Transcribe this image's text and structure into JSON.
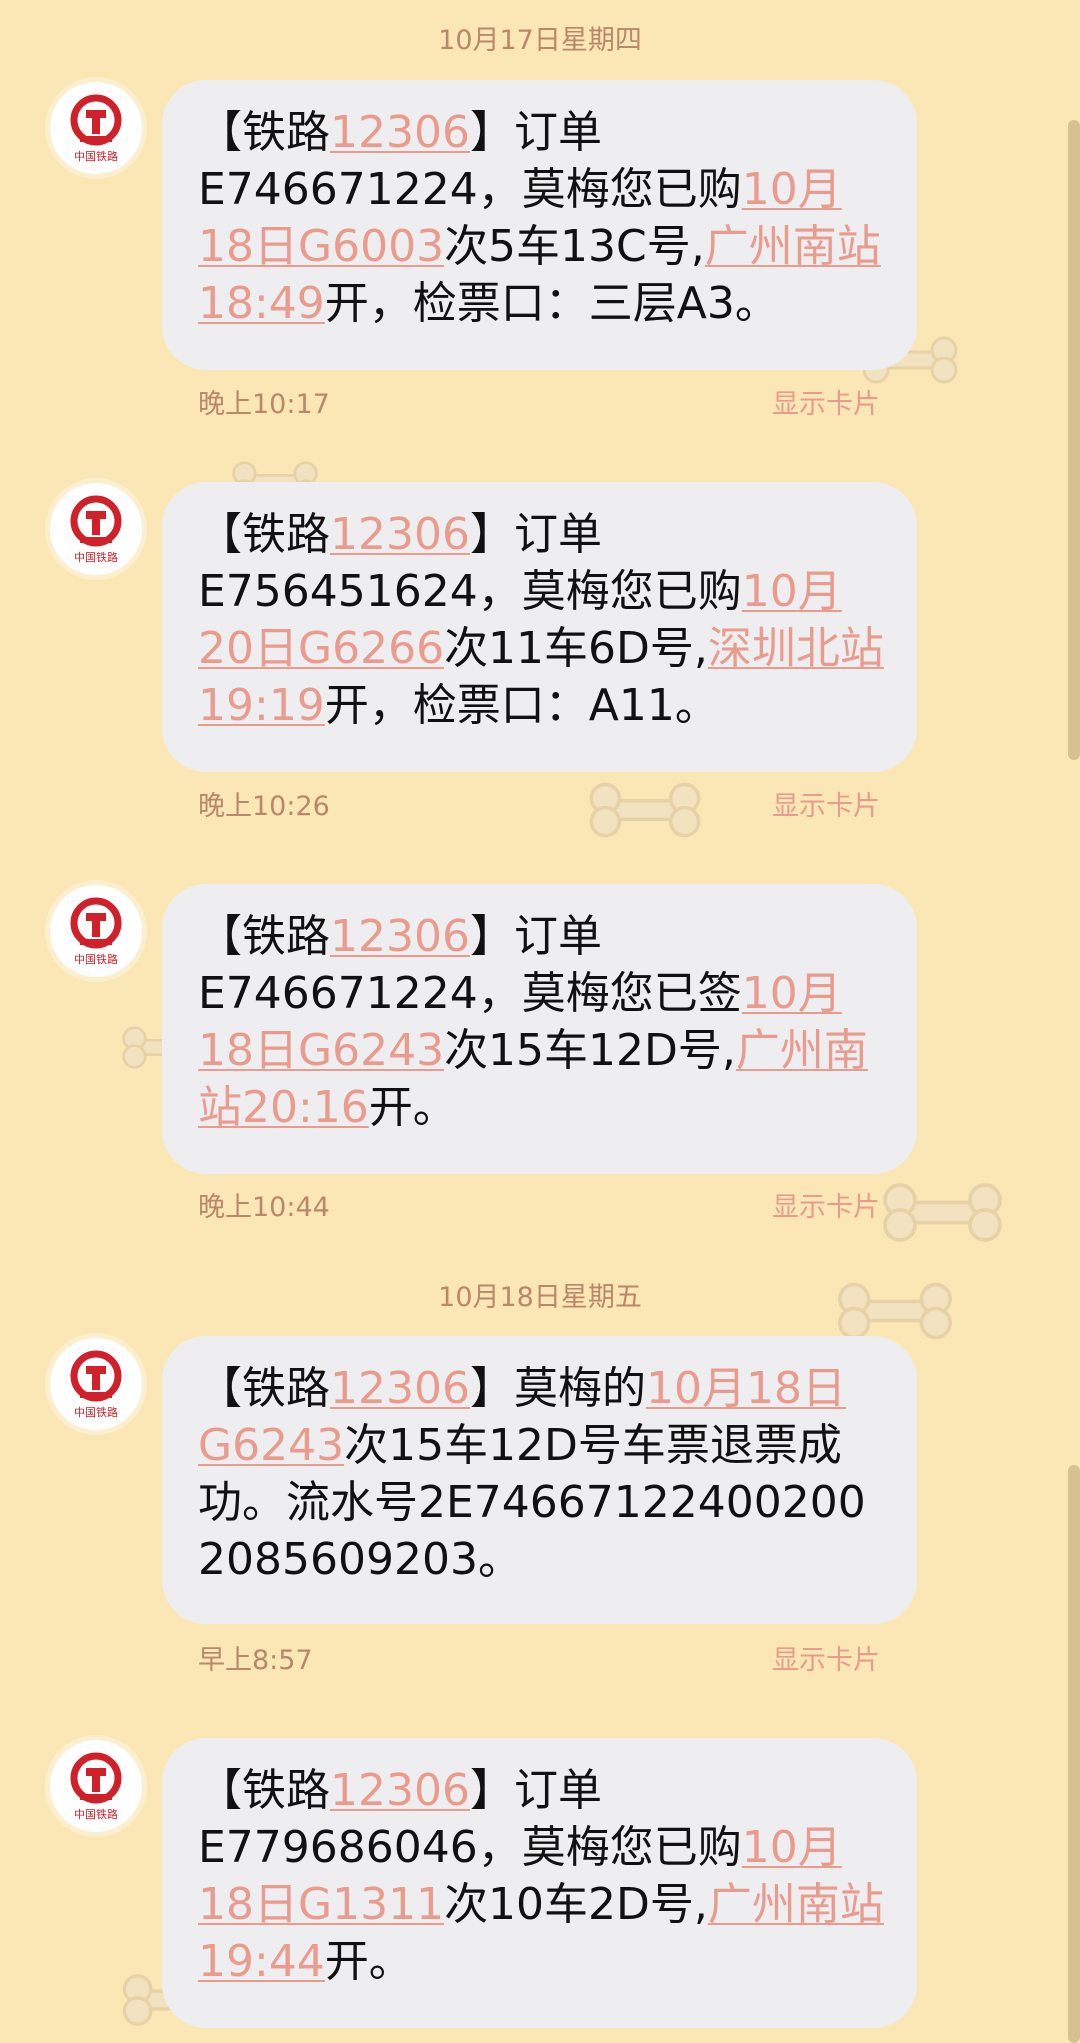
{
  "dates": {
    "first": "10月17日星期四",
    "second": "10月18日星期五"
  },
  "sender": {
    "name": "中国铁路",
    "icon": "china-railway-logo",
    "logo_color": "#d0202a"
  },
  "show_card_label": "显示卡片",
  "colors": {
    "background": "#fbe7b6",
    "bubble": "#eeeef0",
    "link": "#e99b8d",
    "meta": "#b9876a"
  },
  "messages": [
    {
      "parts": [
        "【铁路",
        "12306",
        "】订单E746671224，莫梅您已购",
        "10月18日G6003",
        "次5车13C号,",
        "广州南站18:49",
        "开，检票口：三层A3。"
      ],
      "time": "晚上10:17"
    },
    {
      "parts": [
        "【铁路",
        "12306",
        "】订单E756451624，莫梅您已购",
        "10月20日G6266",
        "次11车6D号,",
        "深圳北站19:19",
        "开，检票口：A11。"
      ],
      "time": "晚上10:26"
    },
    {
      "parts": [
        "【铁路",
        "12306",
        "】订单E746671224，莫梅您已签",
        "10月18日G6243",
        "次15车12D号,",
        "广州南站20:16",
        "开。"
      ],
      "time": "晚上10:44"
    },
    {
      "parts": [
        "【铁路",
        "12306",
        "】莫梅的",
        "10月18日G6243",
        "次15车12D号车票退票成功。流水号2E746671224002002085609203。"
      ],
      "time": "早上8:57"
    },
    {
      "parts": [
        "【铁路",
        "12306",
        "】订单E779686046，莫梅您已购",
        "10月18日G1311",
        "次10车2D号,",
        "广州南站19:44",
        "开。"
      ],
      "time": ""
    }
  ]
}
